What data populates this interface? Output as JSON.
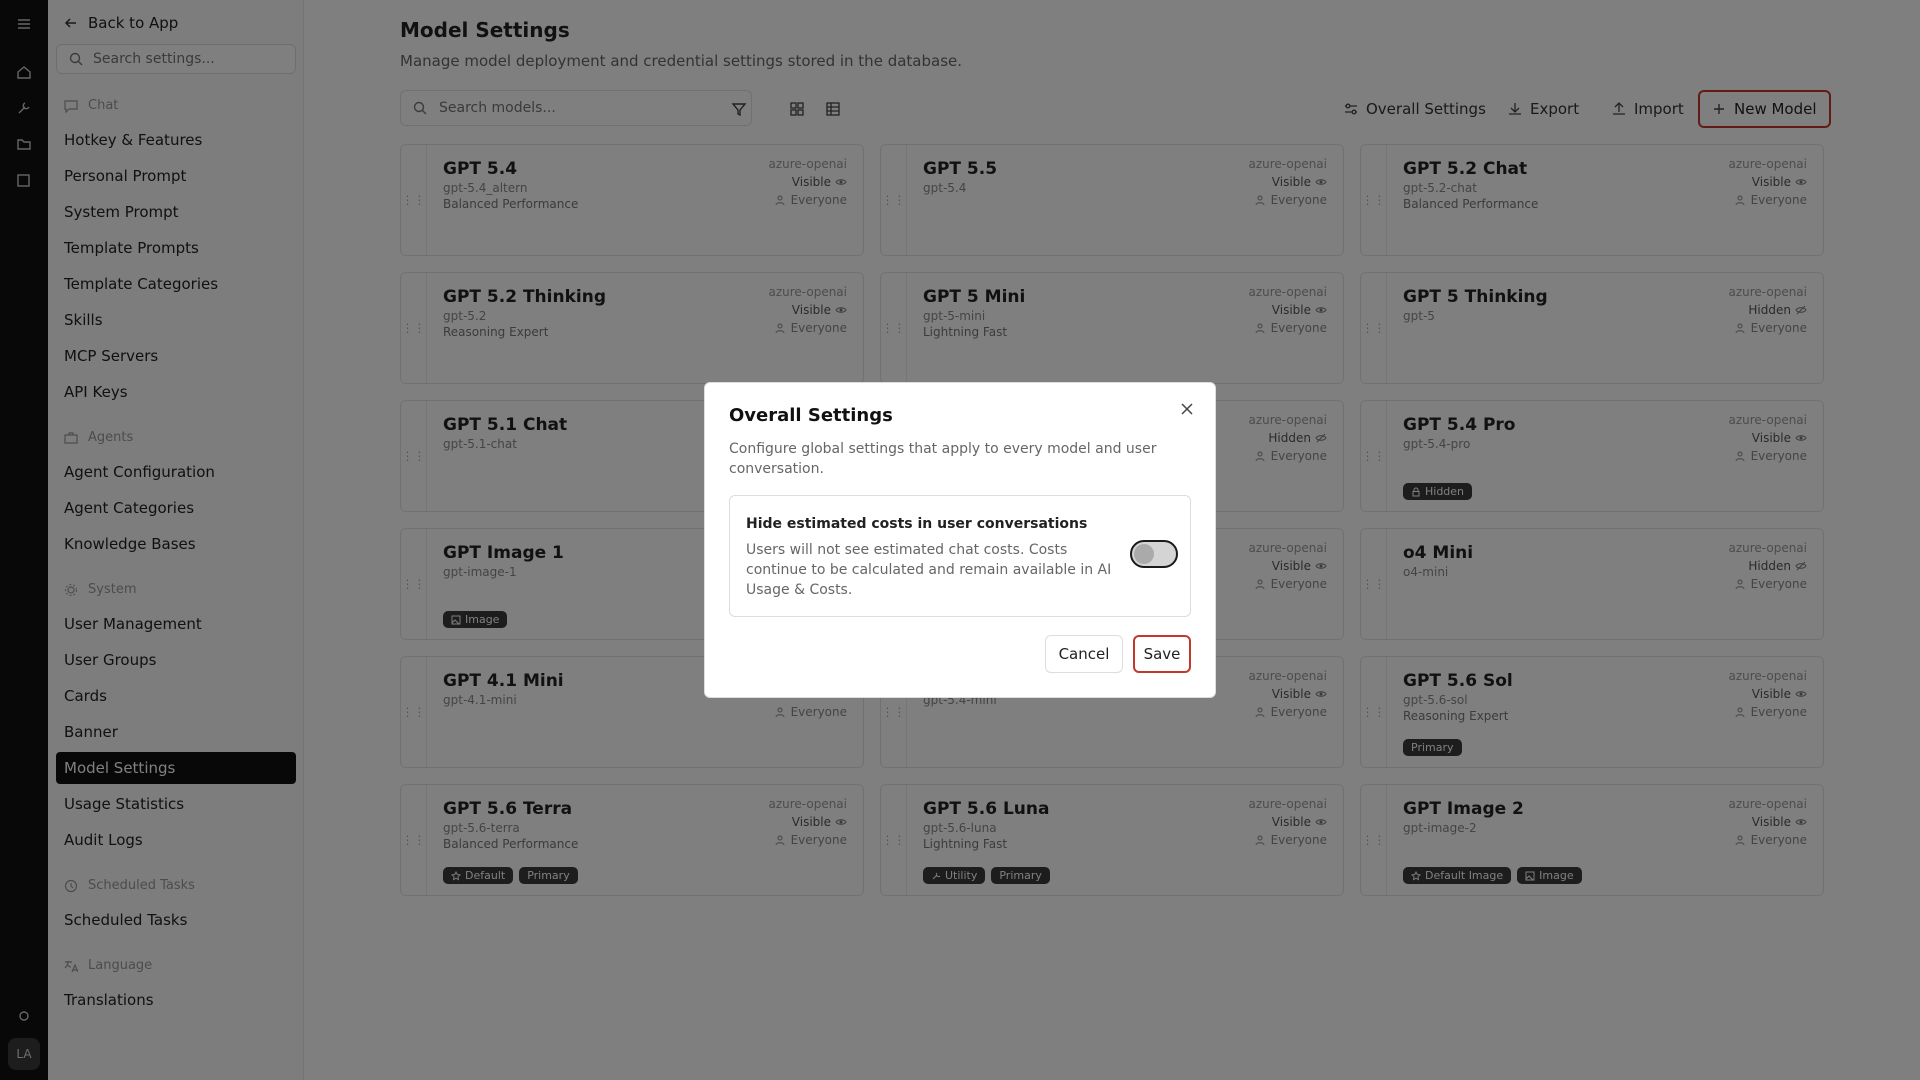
{
  "sidebar": {
    "back_label": "Back to App",
    "search_placeholder": "Search settings...",
    "sections": [
      {
        "label": "Chat",
        "icon": "chat-icon",
        "items": [
          "Hotkey & Features",
          "Personal Prompt",
          "System Prompt",
          "Template Prompts",
          "Template Categories",
          "Skills",
          "MCP Servers",
          "API Keys"
        ]
      },
      {
        "label": "Agents",
        "icon": "briefcase-icon",
        "items": [
          "Agent Configuration",
          "Agent Categories",
          "Knowledge Bases"
        ]
      },
      {
        "label": "System",
        "icon": "gear-icon",
        "items": [
          "User Management",
          "User Groups",
          "Cards",
          "Banner",
          "Model Settings",
          "Usage Statistics",
          "Audit Logs"
        ]
      },
      {
        "label": "Scheduled Tasks",
        "icon": "clock-icon",
        "items": [
          "Scheduled Tasks"
        ]
      },
      {
        "label": "Language",
        "icon": "translate-icon",
        "items": [
          "Translations"
        ]
      }
    ],
    "active_item": "Model Settings"
  },
  "rail": {
    "avatar": "LA"
  },
  "main": {
    "title": "Model Settings",
    "subtitle": "Manage model deployment and credential settings stored in the database.",
    "search_placeholder": "Search models...",
    "toolbar": {
      "overall_settings": "Overall Settings",
      "export": "Export",
      "import": "Import",
      "new_model": "New Model"
    }
  },
  "models": [
    {
      "name": "GPT 5.4",
      "code": "gpt-5.4_altern",
      "desc": "Balanced Performance",
      "provider": "azure-openai",
      "visibility": "Visible",
      "audience": "Everyone",
      "tags": []
    },
    {
      "name": "GPT 5.5",
      "code": "gpt-5.4",
      "desc": "",
      "provider": "azure-openai",
      "visibility": "Visible",
      "audience": "Everyone",
      "tags": []
    },
    {
      "name": "GPT 5.2 Chat",
      "code": "gpt-5.2-chat",
      "desc": "Balanced Performance",
      "provider": "azure-openai",
      "visibility": "Visible",
      "audience": "Everyone",
      "tags": []
    },
    {
      "name": "GPT 5.2 Thinking",
      "code": "gpt-5.2",
      "desc": "Reasoning Expert",
      "provider": "azure-openai",
      "visibility": "Visible",
      "audience": "Everyone",
      "tags": []
    },
    {
      "name": "GPT 5 Mini",
      "code": "gpt-5-mini",
      "desc": "Lightning Fast",
      "provider": "azure-openai",
      "visibility": "Visible",
      "audience": "Everyone",
      "tags": []
    },
    {
      "name": "GPT 5 Thinking",
      "code": "gpt-5",
      "desc": "",
      "provider": "azure-openai",
      "visibility": "Hidden",
      "audience": "Everyone",
      "tags": []
    },
    {
      "name": "GPT 5.1 Chat",
      "code": "gpt-5.1-chat",
      "desc": "",
      "provider": "",
      "visibility": "",
      "audience": "",
      "tags": []
    },
    {
      "name": "",
      "code": "",
      "desc": "",
      "provider": "azure-openai",
      "visibility": "Hidden",
      "audience": "Everyone",
      "tags": []
    },
    {
      "name": "GPT 5.4 Pro",
      "code": "gpt-5.4-pro",
      "desc": "",
      "provider": "azure-openai",
      "visibility": "Visible",
      "audience": "Everyone",
      "tags": [
        {
          "label": "Hidden",
          "icon": "lock-icon"
        }
      ]
    },
    {
      "name": "GPT Image 1",
      "code": "gpt-image-1",
      "desc": "",
      "provider": "",
      "visibility": "",
      "audience": "",
      "tags": [
        {
          "label": "Image",
          "icon": "image-icon"
        }
      ]
    },
    {
      "name": "",
      "code": "",
      "desc": "",
      "provider": "azure-openai",
      "visibility": "Visible",
      "audience": "Everyone",
      "tags": []
    },
    {
      "name": "o4 Mini",
      "code": "o4-mini",
      "desc": "",
      "provider": "azure-openai",
      "visibility": "Hidden",
      "audience": "Everyone",
      "tags": []
    },
    {
      "name": "GPT 4.1 Mini",
      "code": "gpt-4.1-mini",
      "desc": "",
      "provider": "",
      "visibility": "",
      "audience": "Everyone",
      "tags": []
    },
    {
      "name": "",
      "code": "gpt-5.4-mini",
      "desc": "",
      "provider": "azure-openai",
      "visibility": "Visible",
      "audience": "Everyone",
      "tags": []
    },
    {
      "name": "GPT 5.6 Sol",
      "code": "gpt-5.6-sol",
      "desc": "Reasoning Expert",
      "provider": "azure-openai",
      "visibility": "Visible",
      "audience": "Everyone",
      "tags": [
        {
          "label": "Primary",
          "icon": ""
        }
      ]
    },
    {
      "name": "GPT 5.6 Terra",
      "code": "gpt-5.6-terra",
      "desc": "Balanced Performance",
      "provider": "azure-openai",
      "visibility": "Visible",
      "audience": "Everyone",
      "tags": [
        {
          "label": "Default",
          "icon": "star-icon"
        },
        {
          "label": "Primary",
          "icon": ""
        }
      ]
    },
    {
      "name": "GPT 5.6 Luna",
      "code": "gpt-5.6-luna",
      "desc": "Lightning Fast",
      "provider": "azure-openai",
      "visibility": "Visible",
      "audience": "Everyone",
      "tags": [
        {
          "label": "Utility",
          "icon": "wrench-icon"
        },
        {
          "label": "Primary",
          "icon": ""
        }
      ]
    },
    {
      "name": "GPT Image 2",
      "code": "gpt-image-2",
      "desc": "",
      "provider": "azure-openai",
      "visibility": "Visible",
      "audience": "Everyone",
      "tags": [
        {
          "label": "Default Image",
          "icon": "star-icon"
        },
        {
          "label": "Image",
          "icon": "image-icon"
        }
      ]
    }
  ],
  "modal": {
    "title": "Overall Settings",
    "description": "Configure global settings that apply to every model and user conversation.",
    "option_title": "Hide estimated costs in user conversations",
    "option_description": "Users will not see estimated chat costs. Costs continue to be calculated and remain available in AI Usage & Costs.",
    "toggle_on": false,
    "cancel_label": "Cancel",
    "save_label": "Save"
  }
}
